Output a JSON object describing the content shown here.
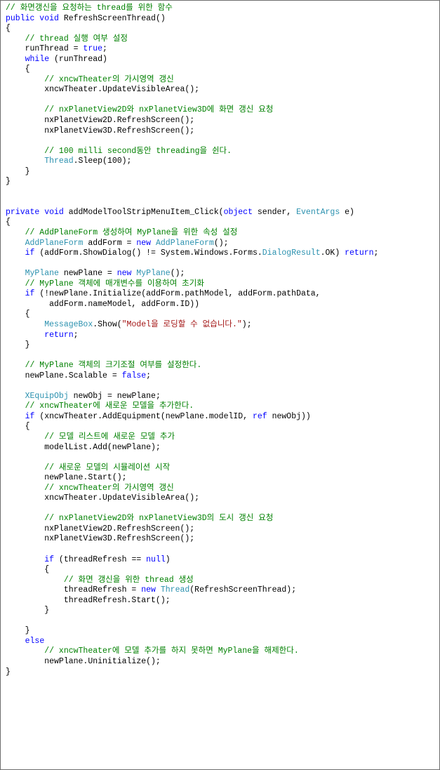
{
  "document": {
    "title": "C# Source Code Listing",
    "language": "csharp",
    "background_color": "#ffffff",
    "border_color": "#6e6e6e",
    "syntax_colors": {
      "plain": "#000000",
      "keyword": "#0000ff",
      "type": "#2b91af",
      "comment": "#008000",
      "string": "#a31515"
    }
  },
  "code": {
    "lines": [
      [
        {
          "t": "comment",
          "s": "// 화면갱신을 요청하는 thread를 위한 함수"
        }
      ],
      [
        {
          "t": "key",
          "s": "public void "
        },
        {
          "t": "plain",
          "s": "RefreshScreenThread()"
        }
      ],
      [
        {
          "t": "plain",
          "s": "{"
        }
      ],
      [
        {
          "t": "comment",
          "s": "    // thread 실행 여부 설정"
        }
      ],
      [
        {
          "t": "plain",
          "s": "    runThread = "
        },
        {
          "t": "key",
          "s": "true"
        },
        {
          "t": "plain",
          "s": ";"
        }
      ],
      [
        {
          "t": "plain",
          "s": "    "
        },
        {
          "t": "key",
          "s": "while"
        },
        {
          "t": "plain",
          "s": " (runThread)"
        }
      ],
      [
        {
          "t": "plain",
          "s": "    {"
        }
      ],
      [
        {
          "t": "comment",
          "s": "        // xncwTheater의 가시영역 갱신"
        }
      ],
      [
        {
          "t": "plain",
          "s": "        xncwTheater.UpdateVisibleArea();"
        }
      ],
      [
        {
          "t": "plain",
          "s": ""
        }
      ],
      [
        {
          "t": "comment",
          "s": "        // nxPlanetView2D와 nxPlanetView3D에 화면 갱신 요청"
        }
      ],
      [
        {
          "t": "plain",
          "s": "        nxPlanetView2D.RefreshScreen();"
        }
      ],
      [
        {
          "t": "plain",
          "s": "        nxPlanetView3D.RefreshScreen();"
        }
      ],
      [
        {
          "t": "plain",
          "s": ""
        }
      ],
      [
        {
          "t": "comment",
          "s": "        // 100 milli second동안 threading을 쉰다."
        }
      ],
      [
        {
          "t": "plain",
          "s": "        "
        },
        {
          "t": "type",
          "s": "Thread"
        },
        {
          "t": "plain",
          "s": ".Sleep(100);"
        }
      ],
      [
        {
          "t": "plain",
          "s": "    }"
        }
      ],
      [
        {
          "t": "plain",
          "s": "}"
        }
      ],
      [
        {
          "t": "plain",
          "s": ""
        }
      ],
      [
        {
          "t": "plain",
          "s": ""
        }
      ],
      [
        {
          "t": "key",
          "s": "private void "
        },
        {
          "t": "plain",
          "s": "addModelToolStripMenuItem_Click("
        },
        {
          "t": "key",
          "s": "object"
        },
        {
          "t": "plain",
          "s": " sender, "
        },
        {
          "t": "type",
          "s": "EventArgs"
        },
        {
          "t": "plain",
          "s": " e)"
        }
      ],
      [
        {
          "t": "plain",
          "s": "{"
        }
      ],
      [
        {
          "t": "comment",
          "s": "    // AddPlaneForm 생성하여 MyPlane을 위한 속성 설정"
        }
      ],
      [
        {
          "t": "plain",
          "s": "    "
        },
        {
          "t": "type",
          "s": "AddPlaneForm"
        },
        {
          "t": "plain",
          "s": " addForm = "
        },
        {
          "t": "key",
          "s": "new"
        },
        {
          "t": "plain",
          "s": " "
        },
        {
          "t": "type",
          "s": "AddPlaneForm"
        },
        {
          "t": "plain",
          "s": "();"
        }
      ],
      [
        {
          "t": "plain",
          "s": "    "
        },
        {
          "t": "key",
          "s": "if"
        },
        {
          "t": "plain",
          "s": " (addForm.ShowDialog() != System.Windows.Forms."
        },
        {
          "t": "type",
          "s": "DialogResult"
        },
        {
          "t": "plain",
          "s": ".OK) "
        },
        {
          "t": "key",
          "s": "return"
        },
        {
          "t": "plain",
          "s": ";"
        }
      ],
      [
        {
          "t": "plain",
          "s": ""
        }
      ],
      [
        {
          "t": "plain",
          "s": "    "
        },
        {
          "t": "type",
          "s": "MyPlane"
        },
        {
          "t": "plain",
          "s": " newPlane = "
        },
        {
          "t": "key",
          "s": "new"
        },
        {
          "t": "plain",
          "s": " "
        },
        {
          "t": "type",
          "s": "MyPlane"
        },
        {
          "t": "plain",
          "s": "();"
        }
      ],
      [
        {
          "t": "comment",
          "s": "    // MyPlane 객체에 매개변수를 이용하여 초기화"
        }
      ],
      [
        {
          "t": "plain",
          "s": "    "
        },
        {
          "t": "key",
          "s": "if"
        },
        {
          "t": "plain",
          "s": " (!newPlane.Initialize(addForm.pathModel, addForm.pathData,"
        }
      ],
      [
        {
          "t": "plain",
          "s": "         addForm.nameModel, addForm.ID))"
        }
      ],
      [
        {
          "t": "plain",
          "s": "    {"
        }
      ],
      [
        {
          "t": "plain",
          "s": "        "
        },
        {
          "t": "type",
          "s": "MessageBox"
        },
        {
          "t": "plain",
          "s": ".Show("
        },
        {
          "t": "string",
          "s": "\"Model을 로딩할 수 없습니다.\""
        },
        {
          "t": "plain",
          "s": ");"
        }
      ],
      [
        {
          "t": "plain",
          "s": "        "
        },
        {
          "t": "key",
          "s": "return"
        },
        {
          "t": "plain",
          "s": ";"
        }
      ],
      [
        {
          "t": "plain",
          "s": "    }"
        }
      ],
      [
        {
          "t": "plain",
          "s": ""
        }
      ],
      [
        {
          "t": "comment",
          "s": "    // MyPlane 객체의 크기조절 여부를 설정한다."
        }
      ],
      [
        {
          "t": "plain",
          "s": "    newPlane.Scalable = "
        },
        {
          "t": "key",
          "s": "false"
        },
        {
          "t": "plain",
          "s": ";"
        }
      ],
      [
        {
          "t": "plain",
          "s": ""
        }
      ],
      [
        {
          "t": "plain",
          "s": "    "
        },
        {
          "t": "type",
          "s": "XEquipObj"
        },
        {
          "t": "plain",
          "s": " newObj = newPlane;"
        }
      ],
      [
        {
          "t": "comment",
          "s": "    // xncwTheater에 새로운 모델을 추가한다."
        }
      ],
      [
        {
          "t": "plain",
          "s": "    "
        },
        {
          "t": "key",
          "s": "if"
        },
        {
          "t": "plain",
          "s": " (xncwTheater.AddEquipment(newPlane.modelID, "
        },
        {
          "t": "key",
          "s": "ref"
        },
        {
          "t": "plain",
          "s": " newObj))"
        }
      ],
      [
        {
          "t": "plain",
          "s": "    {"
        }
      ],
      [
        {
          "t": "comment",
          "s": "        // 모델 리스트에 새로운 모델 추가"
        }
      ],
      [
        {
          "t": "plain",
          "s": "        modelList.Add(newPlane);"
        }
      ],
      [
        {
          "t": "plain",
          "s": ""
        }
      ],
      [
        {
          "t": "comment",
          "s": "        // 새로운 모델의 시뮬레이션 시작"
        }
      ],
      [
        {
          "t": "plain",
          "s": "        newPlane.Start();"
        }
      ],
      [
        {
          "t": "comment",
          "s": "        // xncwTheater의 가시영역 갱신"
        }
      ],
      [
        {
          "t": "plain",
          "s": "        xncwTheater.UpdateVisibleArea();"
        }
      ],
      [
        {
          "t": "plain",
          "s": ""
        }
      ],
      [
        {
          "t": "comment",
          "s": "        // nxPlanetView2D와 nxPlanetView3D의 도시 갱신 요청"
        }
      ],
      [
        {
          "t": "plain",
          "s": "        nxPlanetView2D.RefreshScreen();"
        }
      ],
      [
        {
          "t": "plain",
          "s": "        nxPlanetView3D.RefreshScreen();"
        }
      ],
      [
        {
          "t": "plain",
          "s": ""
        }
      ],
      [
        {
          "t": "plain",
          "s": "        "
        },
        {
          "t": "key",
          "s": "if"
        },
        {
          "t": "plain",
          "s": " (threadRefresh == "
        },
        {
          "t": "key",
          "s": "null"
        },
        {
          "t": "plain",
          "s": ")"
        }
      ],
      [
        {
          "t": "plain",
          "s": "        {"
        }
      ],
      [
        {
          "t": "comment",
          "s": "            // 화면 갱신을 위한 thread 생성"
        }
      ],
      [
        {
          "t": "plain",
          "s": "            threadRefresh = "
        },
        {
          "t": "key",
          "s": "new"
        },
        {
          "t": "plain",
          "s": " "
        },
        {
          "t": "type",
          "s": "Thread"
        },
        {
          "t": "plain",
          "s": "(RefreshScreenThread);"
        }
      ],
      [
        {
          "t": "plain",
          "s": "            threadRefresh.Start();"
        }
      ],
      [
        {
          "t": "plain",
          "s": "        }"
        }
      ],
      [
        {
          "t": "plain",
          "s": ""
        }
      ],
      [
        {
          "t": "plain",
          "s": "    }"
        }
      ],
      [
        {
          "t": "plain",
          "s": "    "
        },
        {
          "t": "key",
          "s": "else"
        }
      ],
      [
        {
          "t": "comment",
          "s": "        // xncwTheater에 모델 추가를 하지 못하면 MyPlane을 해제한다."
        }
      ],
      [
        {
          "t": "plain",
          "s": "        newPlane.Uninitialize();"
        }
      ],
      [
        {
          "t": "plain",
          "s": "}"
        }
      ]
    ]
  }
}
